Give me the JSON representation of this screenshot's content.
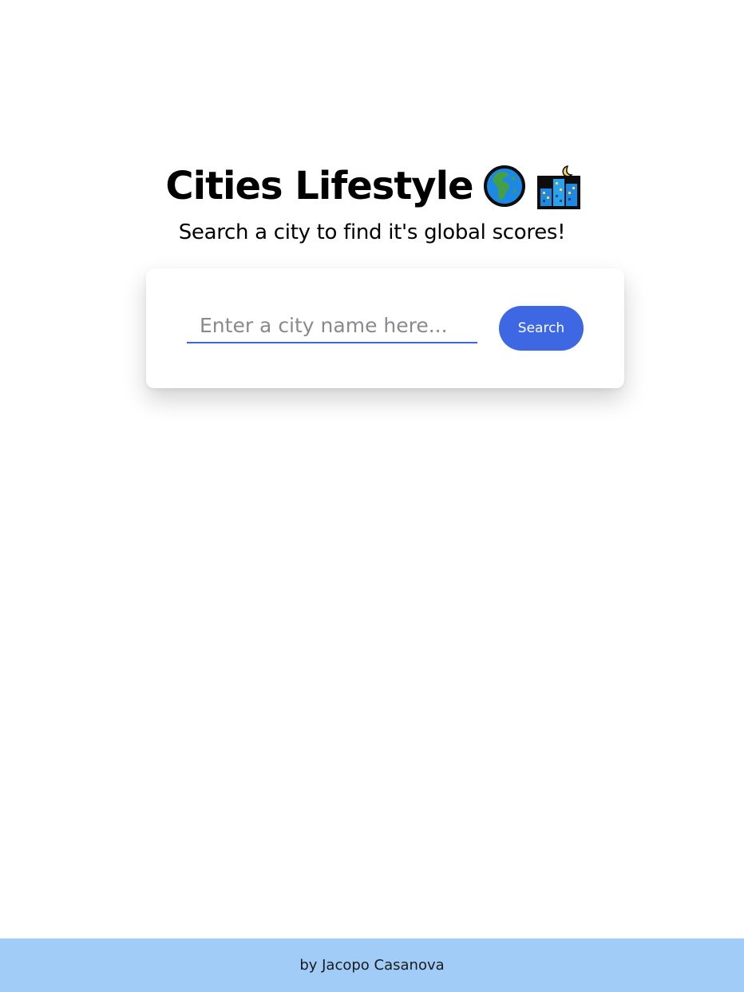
{
  "header": {
    "title": "Cities Lifestyle",
    "title_icons": [
      "globe-europe-africa-icon",
      "night-city-icon"
    ],
    "subtitle": "Search a city to find it's global scores!"
  },
  "search": {
    "placeholder": "Enter a city name here...",
    "value": "",
    "button_label": "Search"
  },
  "footer": {
    "text": "by Jacopo Casanova"
  },
  "colors": {
    "accent": "#3d67e3",
    "footer_bg": "#a1ccf8",
    "background": "#ffffff"
  }
}
